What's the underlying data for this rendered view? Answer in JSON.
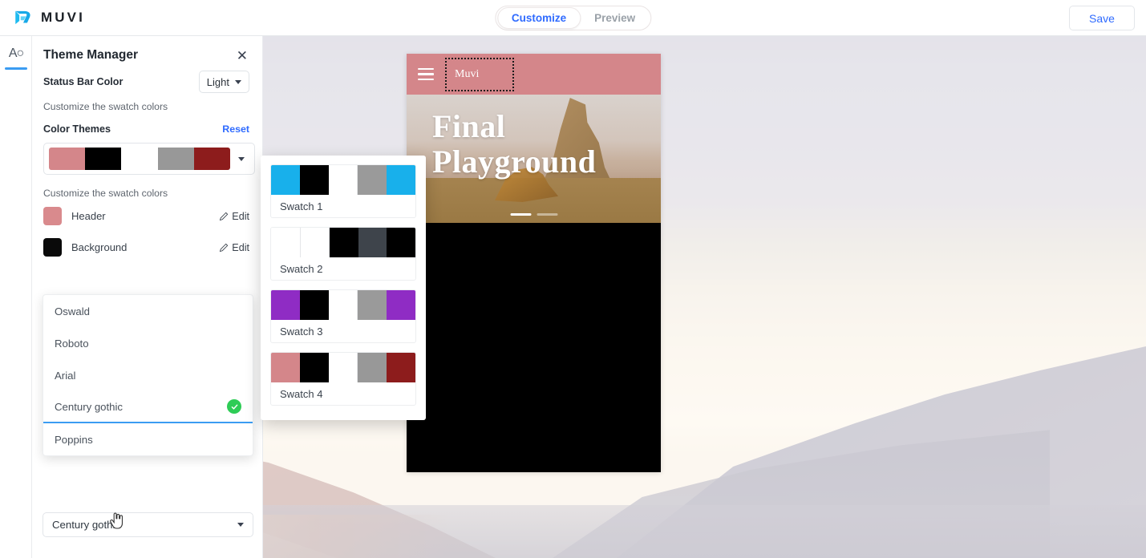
{
  "topbar": {
    "brand_name": "MUVI",
    "brand_icon": "muvi-logo-icon",
    "tabs": [
      {
        "label": "Customize",
        "active": true
      },
      {
        "label": "Preview",
        "active": false
      }
    ],
    "save_label": "Save"
  },
  "rail": {
    "items": [
      {
        "name": "typography",
        "glyph": "A○",
        "active": true
      }
    ]
  },
  "panel": {
    "title": "Theme Manager",
    "close_glyph": "✕",
    "status_bar_label": "Status Bar Color",
    "status_bar_value": "Light",
    "hint_top": "Customize the swatch colors",
    "color_themes_label": "Color Themes",
    "reset_label": "Reset",
    "hint_mid": "Customize the swatch colors",
    "selected_theme_colors": [
      "#d4868a",
      "#000000",
      "#ffffff",
      "#989898",
      "#8d1c1c"
    ],
    "color_rows": [
      {
        "name": "Header",
        "color": "#d98a8d",
        "edit_label": "Edit"
      },
      {
        "name": "Background",
        "color": "#0a0a0a",
        "edit_label": "Edit"
      }
    ],
    "font_select_value": "Century gothic",
    "font_options": [
      {
        "label": "Oswald",
        "selected": false
      },
      {
        "label": "Roboto",
        "selected": false
      },
      {
        "label": "Arial",
        "selected": false
      },
      {
        "label": "Century gothic",
        "selected": true
      },
      {
        "label": "Poppins",
        "selected": false
      }
    ]
  },
  "swatch_popover": {
    "items": [
      {
        "label": "Swatch 1",
        "colors": [
          "#18b0eb",
          "#000000",
          "#ffffff",
          "#9a9a9a",
          "#18b0eb"
        ]
      },
      {
        "label": "Swatch 2",
        "colors": [
          "#ffffff",
          "#ffffff",
          "#000000",
          "#3e444b",
          "#000000"
        ]
      },
      {
        "label": "Swatch 3",
        "colors": [
          "#8f2cc4",
          "#000000",
          "#ffffff",
          "#9a9a9a",
          "#8f2cc4"
        ]
      },
      {
        "label": "Swatch 4",
        "colors": [
          "#d4868a",
          "#000000",
          "#ffffff",
          "#989898",
          "#8d1c1c"
        ]
      }
    ]
  },
  "preview": {
    "header_color": "#d4868a",
    "menu_icon": "hamburger-icon",
    "logo_text": "Muvi",
    "hero_title_line1": "Final",
    "hero_title_line2": "Playground",
    "carousel_dots": 2,
    "carousel_active_index": 0,
    "body_color": "#000000"
  },
  "colors": {
    "accent_blue": "#2f6bff",
    "underline_blue": "#3b9cf2",
    "check_green": "#2ecc56"
  }
}
